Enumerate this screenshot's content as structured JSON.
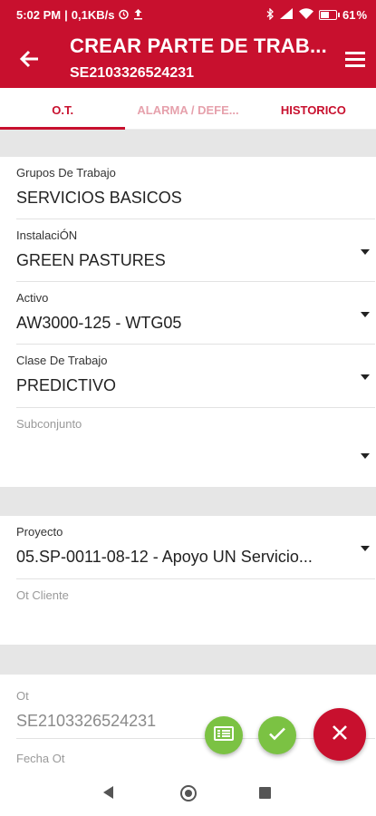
{
  "status_bar": {
    "time": "5:02 PM",
    "network_speed": "0,1KB/s",
    "battery": "61",
    "battery_level": 0.61,
    "icons": [
      "alarm-clock-icon",
      "upload-icon",
      "bluetooth-icon",
      "signal-icon",
      "wifi-icon",
      "battery-icon"
    ]
  },
  "app_bar": {
    "title": "CREAR PARTE DE TRAB...",
    "subtitle": "SE2103326524231",
    "back_icon": "arrow-left-icon",
    "menu_icon": "hamburger-menu-icon"
  },
  "tabs": [
    {
      "label": "O.T.",
      "state": "active"
    },
    {
      "label": "ALARMA / DEFE...",
      "state": "disabled"
    },
    {
      "label": "HISTORICO",
      "state": "normal"
    }
  ],
  "form": {
    "grupos": {
      "label": "Grupos De Trabajo",
      "value": "SERVICIOS BASICOS"
    },
    "instalacion": {
      "label": "InstalaciÓN",
      "value": "GREEN PASTURES"
    },
    "activo": {
      "label": "Activo",
      "value": "AW3000-125 - WTG05"
    },
    "clase": {
      "label": "Clase De Trabajo",
      "value": "PREDICTIVO"
    },
    "subconjunto": {
      "label": "Subconjunto",
      "value": ""
    },
    "proyecto": {
      "label": "Proyecto",
      "value": "05.SP-0011-08-12 - Apoyo UN Servicio..."
    },
    "ot_cliente": {
      "label": "Ot Cliente",
      "value": ""
    },
    "ot": {
      "label": "Ot",
      "value": "SE2103326524231"
    },
    "fecha_ot": {
      "label": "Fecha Ot"
    }
  },
  "fabs": {
    "list_icon": "list-document-icon",
    "confirm_icon": "checkmark-icon",
    "cancel_icon": "close-icon"
  },
  "colors": {
    "primary": "#c8102e",
    "accent_green": "#7bc243",
    "band": "#e6e6e6"
  }
}
